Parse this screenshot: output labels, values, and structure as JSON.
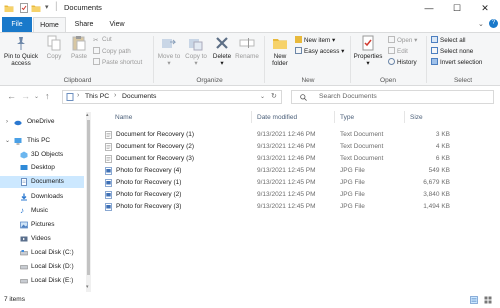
{
  "window": {
    "title": "Documents",
    "controls": {
      "minimize": "—",
      "maximize": "☐",
      "close": "✕"
    }
  },
  "ribbon_tabs": [
    "File",
    "Home",
    "Share",
    "View"
  ],
  "ribbon": {
    "clipboard": {
      "label": "Clipboard",
      "pin": "Pin to Quick access",
      "copy": "Copy",
      "paste": "Paste",
      "cut": "Cut",
      "copy_path": "Copy path",
      "paste_shortcut": "Paste shortcut"
    },
    "organize": {
      "label": "Organize",
      "move_to": "Move to",
      "copy_to": "Copy to",
      "delete": "Delete",
      "rename": "Rename"
    },
    "new": {
      "label": "New",
      "new_folder": "New folder",
      "new_item": "New item",
      "easy_access": "Easy access"
    },
    "open": {
      "label": "Open",
      "properties": "Properties",
      "open": "Open",
      "edit": "Edit",
      "history": "History"
    },
    "select": {
      "label": "Select",
      "select_all": "Select all",
      "select_none": "Select none",
      "invert_selection": "Invert selection"
    }
  },
  "address": {
    "crumbs": [
      "This PC",
      "Documents"
    ],
    "search_placeholder": "Search Documents"
  },
  "nav_pane": [
    {
      "label": "OneDrive",
      "icon": "cloud-icon"
    },
    {
      "label": "This PC",
      "icon": "computer-icon"
    },
    {
      "label": "3D Objects",
      "icon": "cube-icon"
    },
    {
      "label": "Desktop",
      "icon": "desktop-icon"
    },
    {
      "label": "Documents",
      "icon": "documents-icon",
      "selected": true
    },
    {
      "label": "Downloads",
      "icon": "download-icon"
    },
    {
      "label": "Music",
      "icon": "music-icon"
    },
    {
      "label": "Pictures",
      "icon": "pictures-icon"
    },
    {
      "label": "Videos",
      "icon": "video-icon"
    },
    {
      "label": "Local Disk (C:)",
      "icon": "drive-icon"
    },
    {
      "label": "Local Disk (D:)",
      "icon": "drive-icon"
    },
    {
      "label": "Local Disk (E:)",
      "icon": "drive-icon"
    }
  ],
  "columns": [
    "Name",
    "Date modified",
    "Type",
    "Size"
  ],
  "files": [
    {
      "name": "Document for Recovery (1)",
      "date": "9/13/2021 12:46 PM",
      "type": "Text Document",
      "size": "3 KB",
      "icon": "text-file-icon"
    },
    {
      "name": "Document for Recovery (2)",
      "date": "9/13/2021 12:46 PM",
      "type": "Text Document",
      "size": "4 KB",
      "icon": "text-file-icon"
    },
    {
      "name": "Document for Recovery (3)",
      "date": "9/13/2021 12:46 PM",
      "type": "Text Document",
      "size": "6 KB",
      "icon": "text-file-icon"
    },
    {
      "name": "Photo for Recovery (4)",
      "date": "9/13/2021 12:45 PM",
      "type": "JPG File",
      "size": "549 KB",
      "icon": "image-file-icon"
    },
    {
      "name": "Photo for Recovery (1)",
      "date": "9/13/2021 12:45 PM",
      "type": "JPG File",
      "size": "6,679 KB",
      "icon": "image-file-icon"
    },
    {
      "name": "Photo for Recovery (2)",
      "date": "9/13/2021 12:45 PM",
      "type": "JPG File",
      "size": "3,840 KB",
      "icon": "image-file-icon"
    },
    {
      "name": "Photo for Recovery (3)",
      "date": "9/13/2021 12:45 PM",
      "type": "JPG File",
      "size": "1,494 KB",
      "icon": "image-file-icon"
    }
  ],
  "status": {
    "items": "7 items"
  },
  "colors": {
    "accent": "#1979ca",
    "selection": "#cce8ff",
    "ribbon_bg": "#f5f6f7"
  }
}
